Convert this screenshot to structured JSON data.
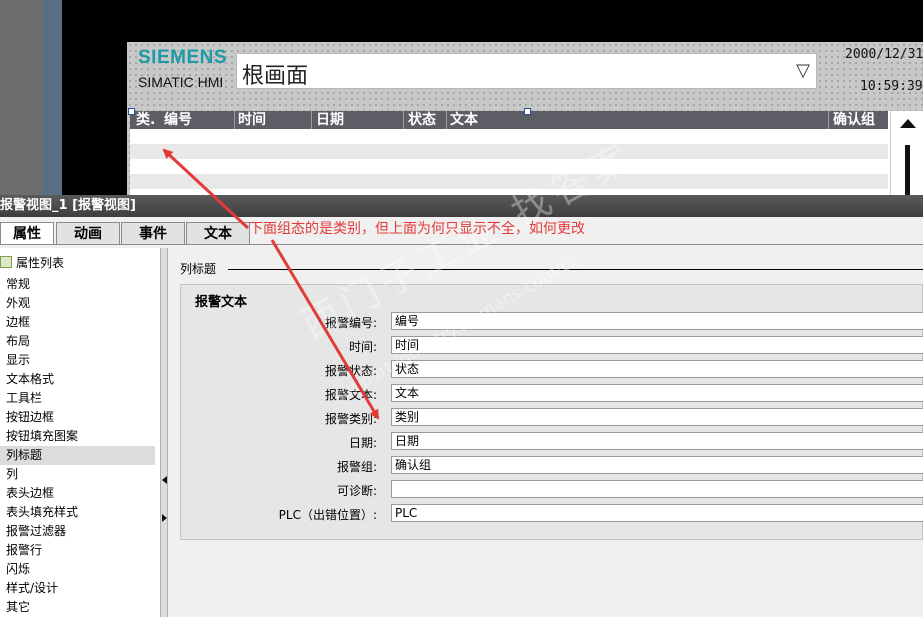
{
  "hmi": {
    "logo": "SIEMENS",
    "product": "SIMATIC HMI",
    "screen_name": "根画面",
    "date": "2000/12/31",
    "time": "10:59:39"
  },
  "alarm_view": {
    "columns": [
      "类.",
      "编号",
      "时间",
      "日期",
      "状态",
      "文本",
      "确认组"
    ]
  },
  "inspector": {
    "title": "报警视图_1 [报警视图]",
    "tabs": [
      "属性",
      "动画",
      "事件",
      "文本"
    ],
    "active_tab": "属性",
    "property_list_label": "属性列表",
    "nav_items": [
      "常规",
      "外观",
      "边框",
      "布局",
      "显示",
      "文本格式",
      "工具栏",
      "按钮边框",
      "按钮填充图案",
      "列标题",
      "列",
      "表头边框",
      "表头填充样式",
      "报警过滤器",
      "报警行",
      "闪烁",
      "样式/设计",
      "其它"
    ],
    "selected_item": "列标题",
    "section_title": "列标题",
    "group_title": "报警文本",
    "fields": [
      {
        "label": "报警编号:",
        "value": "编号"
      },
      {
        "label": "时间:",
        "value": "时间"
      },
      {
        "label": "报警状态:",
        "value": "状态"
      },
      {
        "label": "报警文本:",
        "value": "文本"
      },
      {
        "label": "报警类别:",
        "value": "类别"
      },
      {
        "label": "日期:",
        "value": "日期"
      },
      {
        "label": "报警组:",
        "value": "确认组"
      },
      {
        "label": "可诊断:",
        "value": ""
      },
      {
        "label": "PLC（出错位置）:",
        "value": "PLC"
      }
    ]
  },
  "annotation": {
    "text": "下面组态的是类别，但上面为何只显示不全，如何更改",
    "color": "#e33a3a"
  },
  "watermark": {
    "text": "西门子工业 找答案",
    "url": "support.industry.siemens.com/cs"
  },
  "colors": {
    "siemens_teal": "#1c9aa6",
    "header_gray": "#5d5d66",
    "annotation_red": "#e33a3a"
  }
}
